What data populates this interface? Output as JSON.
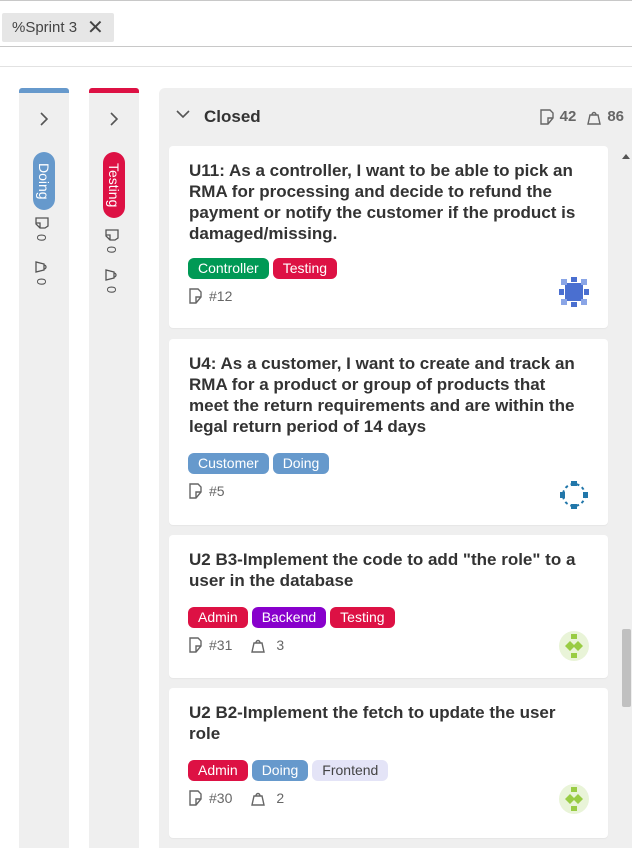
{
  "filter": {
    "label": "%Sprint 3",
    "clear_glyph": "✕"
  },
  "columns_collapsed": [
    {
      "name": "Doing",
      "color": "#6699cc",
      "count_a": "0",
      "count_b": "0"
    },
    {
      "name": "Testing",
      "color": "#dd1144",
      "count_a": "0",
      "count_b": "0"
    }
  ],
  "closed": {
    "title": "Closed",
    "story_count": "42",
    "points": "86",
    "cards": [
      {
        "title": "U11: As a controller, I want to be able to pick an RMA for processing and decide to refund the payment or notify the customer if the product is damaged/missing.",
        "tags": [
          {
            "label": "Controller",
            "color": "#009955"
          },
          {
            "label": "Testing",
            "color": "#dd1144"
          }
        ],
        "id": "#12",
        "points": "",
        "avatar": "blue-square"
      },
      {
        "title": "U4: As a customer, I want to create and track an RMA for a product or group of products that meet the return requirements and are within the legal return period of 14 days",
        "tags": [
          {
            "label": "Customer",
            "color": "#6699cc"
          },
          {
            "label": "Doing",
            "color": "#6699cc"
          }
        ],
        "id": "#5",
        "points": "",
        "avatar": "blue-ring"
      },
      {
        "title": "U2 B3-Implement the code to add \"the role\" to a user in the database",
        "tags": [
          {
            "label": "Admin",
            "color": "#dd1144"
          },
          {
            "label": "Backend",
            "color": "#8800cc"
          },
          {
            "label": "Testing",
            "color": "#dd1144"
          }
        ],
        "id": "#31",
        "points": "3",
        "avatar": "green-check"
      },
      {
        "title": "U2 B2-Implement the fetch to update the user role",
        "tags": [
          {
            "label": "Admin",
            "color": "#dd1144"
          },
          {
            "label": "Doing",
            "color": "#6699cc"
          },
          {
            "label": "Frontend",
            "color": "#e4e4f7",
            "text_color": "#444"
          }
        ],
        "id": "#30",
        "points": "2",
        "avatar": "green-check"
      }
    ]
  }
}
